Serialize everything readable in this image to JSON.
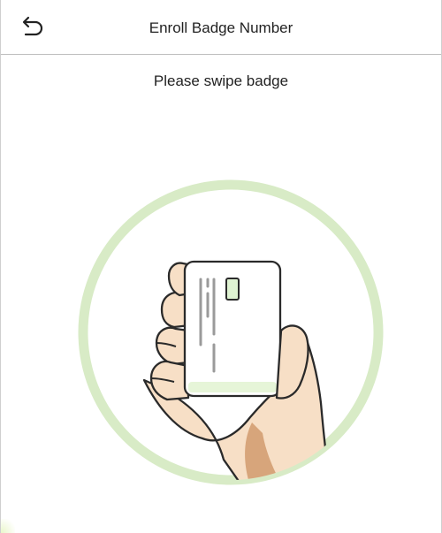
{
  "header": {
    "title": "Enroll Badge Number",
    "back_icon": "back-arrow-icon"
  },
  "main": {
    "prompt": "Please swipe badge",
    "illustration_icon": "hand-holding-badge-icon"
  },
  "colors": {
    "ring": "#d8ebc6",
    "card_accent": "#e6f5d8",
    "skin": "#f7dfc6",
    "skin_shadow": "#d7a57b",
    "outline": "#2a2a2a"
  }
}
